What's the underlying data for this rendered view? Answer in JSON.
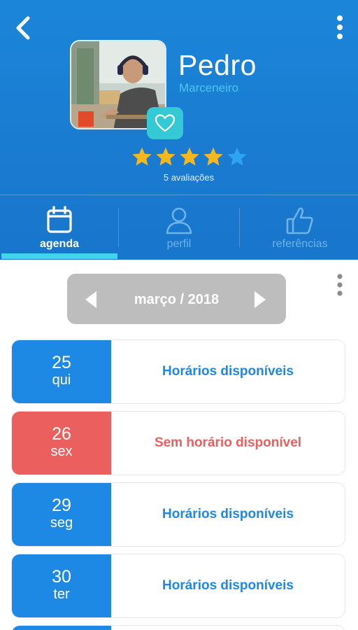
{
  "profile": {
    "name": "Pedro",
    "profession": "Marceneiro",
    "rating": 4,
    "rating_max": 5,
    "reviews_label": "5 avaliações"
  },
  "tabs": [
    {
      "label": "agenda",
      "icon": "calendar-icon",
      "active": true
    },
    {
      "label": "perfil",
      "icon": "person-icon",
      "active": false
    },
    {
      "label": "referências",
      "icon": "thumbs-up-icon",
      "active": false
    }
  ],
  "month_nav": {
    "label": "março / 2018"
  },
  "days": [
    {
      "day": "25",
      "weekday": "qui",
      "status": "Horários disponíveis",
      "available": true
    },
    {
      "day": "26",
      "weekday": "sex",
      "status": "Sem horário disponível",
      "available": false
    },
    {
      "day": "29",
      "weekday": "seg",
      "status": "Horários disponíveis",
      "available": true
    },
    {
      "day": "30",
      "weekday": "ter",
      "status": "Horários disponíveis",
      "available": true
    }
  ],
  "colors": {
    "header_blue": "#1a7bd0",
    "available_blue": "#1e88e5",
    "unavailable_red": "#ec5f5f",
    "star_gold": "#f5b71c",
    "star_empty": "#2fa3f0",
    "accent_cyan": "#3fd6ea",
    "favorite_teal": "#35c9d6"
  }
}
